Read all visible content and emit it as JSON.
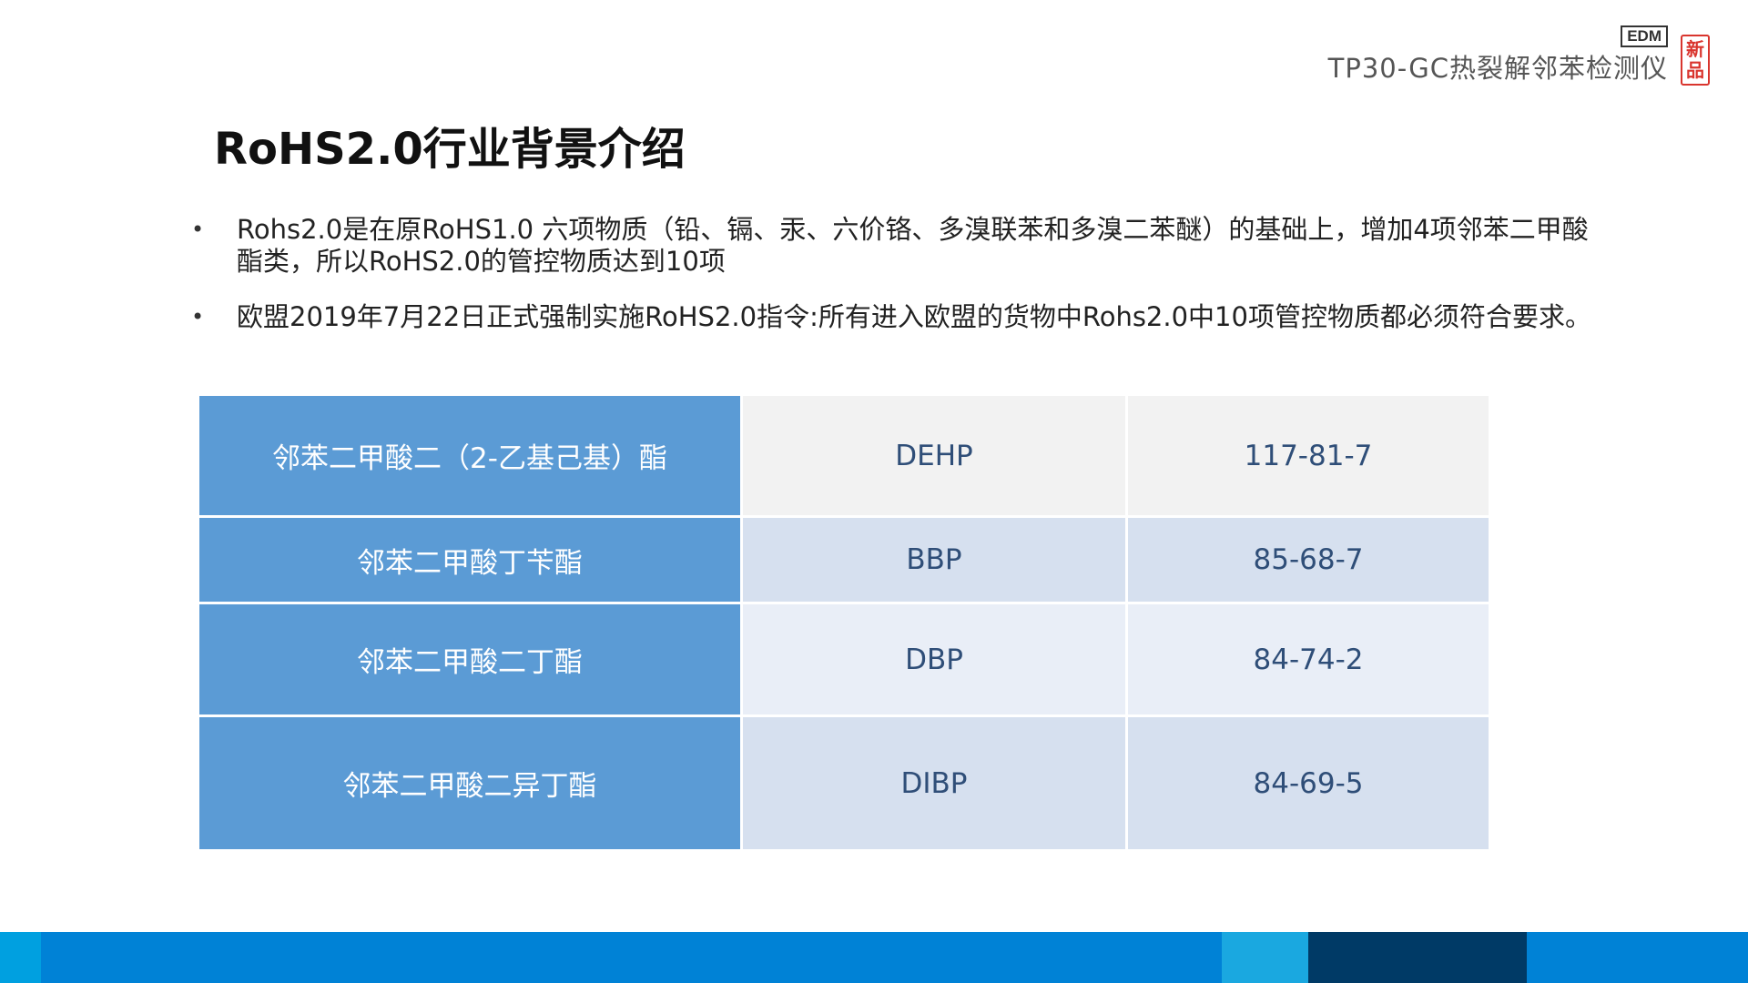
{
  "brand": {
    "edm": "EDM",
    "product": "TP30-GC热裂解邻苯检测仪",
    "seal_top": "新",
    "seal_bottom": "品"
  },
  "title": "RoHS2.0行业背景介绍",
  "bullets": [
    "Rohs2.0是在原RoHS1.0 六项物质（铅、镉、汞、六价铬、多溴联苯和多溴二苯醚）的基础上，增加4项邻苯二甲酸酯类，所以RoHS2.0的管控物质达到10项",
    "欧盟2019年7月22日正式强制实施RoHS2.0指令:所有进入欧盟的货物中Rohs2.0中10项管控物质都必须符合要求。"
  ],
  "table": {
    "rows": [
      {
        "name": "邻苯二甲酸二（2-乙基己基）酯",
        "abbr": "DEHP",
        "cas": "117-81-7"
      },
      {
        "name": "邻苯二甲酸丁苄酯",
        "abbr": "BBP",
        "cas": "85-68-7"
      },
      {
        "name": "邻苯二甲酸二丁酯",
        "abbr": "DBP",
        "cas": "84-74-2"
      },
      {
        "name": "邻苯二甲酸二异丁酯",
        "abbr": "DIBP",
        "cas": "84-69-5"
      }
    ]
  },
  "colors": {
    "table_name_cell": "#5b9bd5",
    "seal": "#d9352e",
    "footer": [
      "#00a0e0",
      "#0082d6",
      "#1aa8e0",
      "#003a66",
      "#0082d6"
    ]
  }
}
